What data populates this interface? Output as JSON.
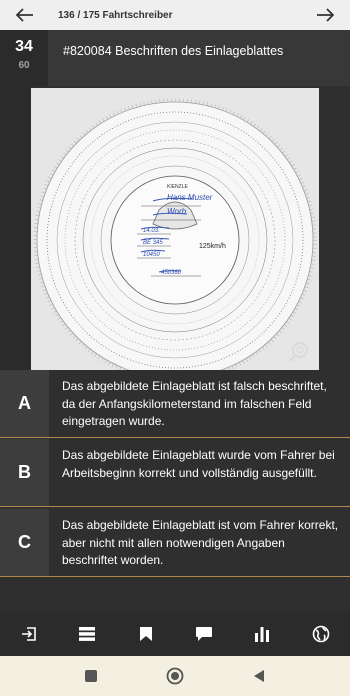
{
  "topbar": {
    "breadcrumb": "136 / 175 Fahrtschreiber"
  },
  "question": {
    "number": "34",
    "points": "60",
    "title": "#820084 Beschriften des Einlageblattes"
  },
  "chart_disc": {
    "name_line": "Hans Muster",
    "place_line": "Worb",
    "date_line": "14.03.",
    "plate_line": "BE 345",
    "km_start": "10450",
    "km_end": "450360",
    "speed_label": "125km/h",
    "brand": "KIENZLE"
  },
  "answers": [
    {
      "letter": "A",
      "text": "Das abgebildete Einlageblatt ist falsch beschriftet, da der Anfangskilometerstand im falschen Feld eingetragen wurde."
    },
    {
      "letter": "B",
      "text": "Das abgebildete Einlageblatt wurde vom Fahrer bei Arbeitsbeginn korrekt und vollständig ausgefüllt."
    },
    {
      "letter": "C",
      "text": "Das abgebildete Einlageblatt ist vom Fahrer korrekt, aber nicht mit allen notwendigen Angaben beschriftet worden."
    }
  ],
  "colors": {
    "accent_border": "#b08a4a",
    "dark_bg": "#2f2f2f"
  },
  "toolbar_icons": [
    "exit-icon",
    "list-icon",
    "bookmark-icon",
    "comment-icon",
    "stats-icon",
    "globe-icon"
  ],
  "sysnav_icons": [
    "recents-icon",
    "home-icon",
    "back-icon"
  ]
}
